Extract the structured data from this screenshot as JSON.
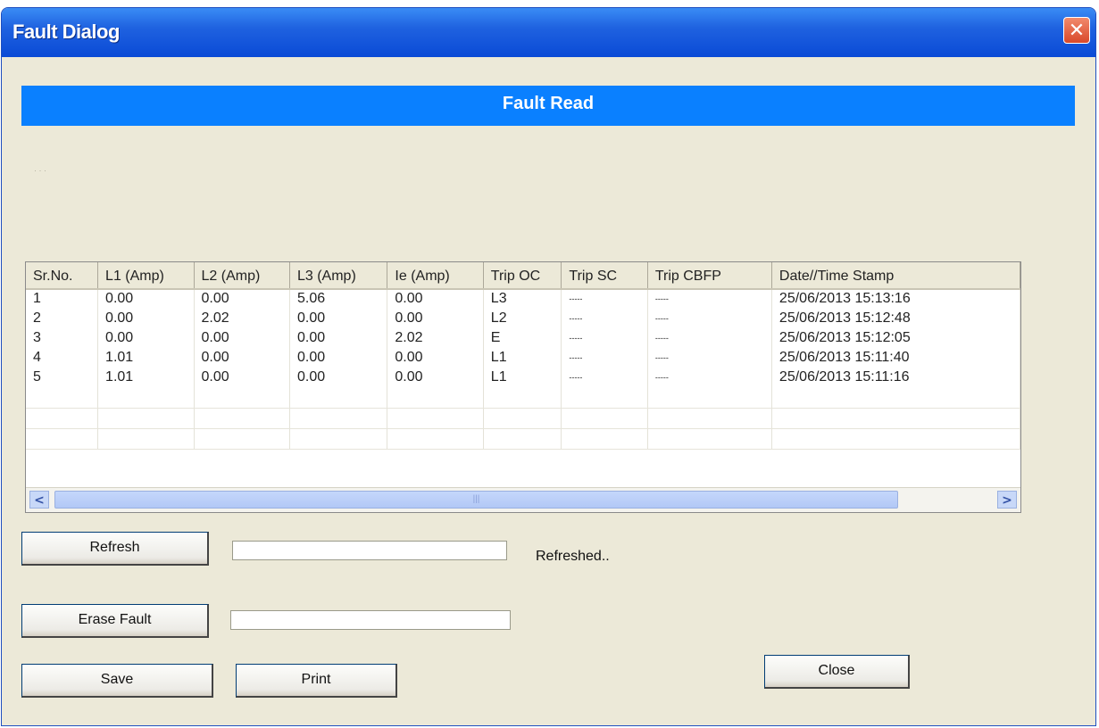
{
  "window": {
    "title": "Fault Dialog",
    "close_glyph": "✕"
  },
  "banner": {
    "text": "Fault Read"
  },
  "tiny_label": "· · ·",
  "table": {
    "columns": [
      "Sr.No.",
      "L1 (Amp)",
      "L2 (Amp)",
      "L3 (Amp)",
      "Ie (Amp)",
      "Trip OC",
      "Trip SC",
      "Trip CBFP",
      "Date//Time Stamp"
    ],
    "rows": [
      [
        "1",
        "0.00",
        "0.00",
        "5.06",
        "0.00",
        "L3",
        "-----",
        "-----",
        "25/06/2013  15:13:16"
      ],
      [
        "2",
        "0.00",
        "2.02",
        "0.00",
        "0.00",
        "L2",
        "-----",
        "-----",
        "25/06/2013  15:12:48"
      ],
      [
        "3",
        "0.00",
        "0.00",
        "0.00",
        "2.02",
        "E",
        "-----",
        "-----",
        "25/06/2013  15:12:05"
      ],
      [
        "4",
        "1.01",
        "0.00",
        "0.00",
        "0.00",
        "L1",
        "-----",
        "-----",
        "25/06/2013  15:11:40"
      ],
      [
        "5",
        "1.01",
        "0.00",
        "0.00",
        "0.00",
        "L1",
        "-----",
        "-----",
        "25/06/2013  15:11:16"
      ]
    ],
    "empty_rows": 3
  },
  "scrollbar": {
    "left_arrow": "<",
    "right_arrow": ">",
    "grip": "|||"
  },
  "buttons": {
    "refresh": "Refresh",
    "erase": "Erase Fault",
    "save": "Save",
    "print": "Print",
    "close": "Close"
  },
  "status": "Refreshed..",
  "colors": {
    "banner": "#0a80ff",
    "titlebar": "#1f62e0",
    "dialog_bg": "#ece9d8"
  }
}
